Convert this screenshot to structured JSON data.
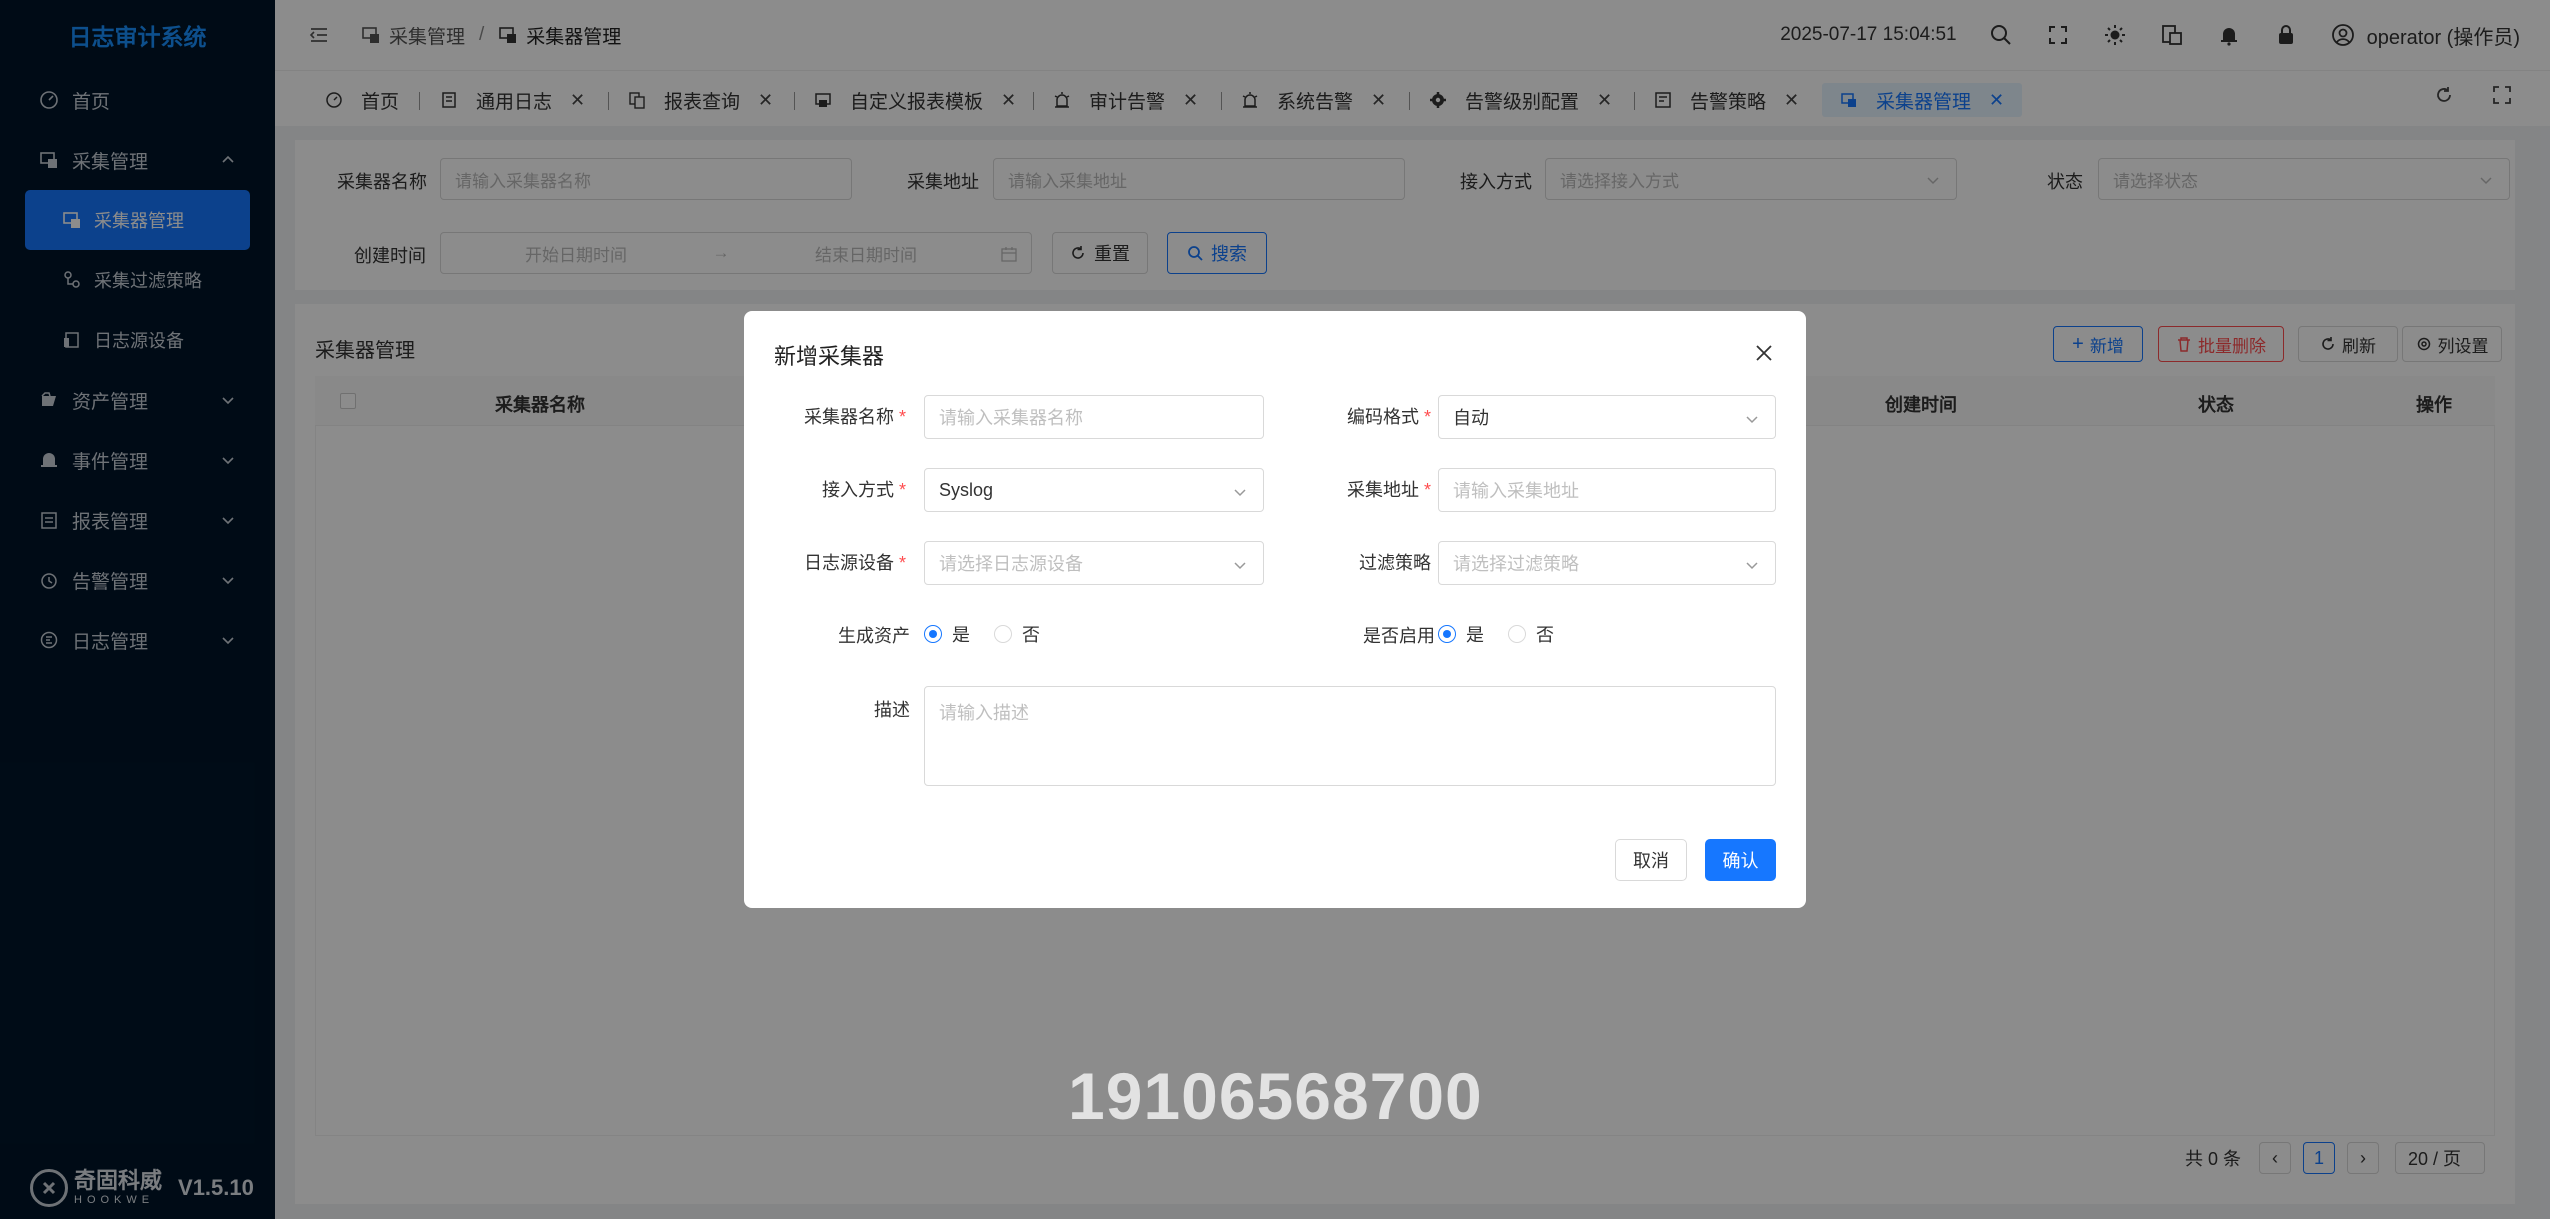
{
  "app": {
    "title": "日志审计系统",
    "version": "V1.5.10",
    "brand_cn": "奇固科威",
    "brand_en": "HOOKWE"
  },
  "sidebar": {
    "items": [
      {
        "label": "首页",
        "icon": "dashboard-icon"
      },
      {
        "label": "采集管理",
        "icon": "collector-icon",
        "expanded": true
      },
      {
        "label": "采集器管理",
        "icon": "collector-icon",
        "sub": true,
        "active": true
      },
      {
        "label": "采集过滤策略",
        "icon": "filter-icon",
        "sub": true
      },
      {
        "label": "日志源设备",
        "icon": "device-icon",
        "sub": true
      },
      {
        "label": "资产管理",
        "icon": "asset-icon"
      },
      {
        "label": "事件管理",
        "icon": "bell-icon"
      },
      {
        "label": "报表管理",
        "icon": "report-icon"
      },
      {
        "label": "告警管理",
        "icon": "alarm-icon"
      },
      {
        "label": "日志管理",
        "icon": "log-icon"
      }
    ]
  },
  "header": {
    "breadcrumb": [
      "采集管理",
      "采集器管理"
    ],
    "datetime": "2025-07-17 15:04:51",
    "user": "operator (操作员)"
  },
  "tabs": [
    {
      "label": "首页",
      "closable": false
    },
    {
      "label": "通用日志",
      "closable": true
    },
    {
      "label": "报表查询",
      "closable": true
    },
    {
      "label": "自定义报表模板",
      "closable": true
    },
    {
      "label": "审计告警",
      "closable": true
    },
    {
      "label": "系统告警",
      "closable": true
    },
    {
      "label": "告警级别配置",
      "closable": true
    },
    {
      "label": "告警策略",
      "closable": true
    },
    {
      "label": "采集器管理",
      "closable": true,
      "active": true
    }
  ],
  "filters": {
    "name_label": "采集器名称",
    "name_placeholder": "请输入采集器名称",
    "addr_label": "采集地址",
    "addr_placeholder": "请输入采集地址",
    "access_label": "接入方式",
    "access_placeholder": "请选择接入方式",
    "status_label": "状态",
    "status_placeholder": "请选择状态",
    "created_label": "创建时间",
    "start_placeholder": "开始日期时间",
    "end_placeholder": "结束日期时间",
    "reset": "重置",
    "search": "搜索"
  },
  "table": {
    "title": "采集器管理",
    "add": "新增",
    "batch_delete": "批量删除",
    "refresh": "刷新",
    "columns": "列设置",
    "headers": {
      "name": "采集器名称",
      "created": "创建时间",
      "status": "状态",
      "ops": "操作"
    },
    "total": "共 0 条",
    "page": "1",
    "page_size": "20 / 页"
  },
  "modal": {
    "title": "新增采集器",
    "name_label": "采集器名称",
    "name_placeholder": "请输入采集器名称",
    "encoding_label": "编码格式",
    "encoding_value": "自动",
    "access_label": "接入方式",
    "access_value": "Syslog",
    "addr_label": "采集地址",
    "addr_placeholder": "请输入采集地址",
    "device_label": "日志源设备",
    "device_placeholder": "请选择日志源设备",
    "filter_label": "过滤策略",
    "filter_placeholder": "请选择过滤策略",
    "gen_asset_label": "生成资产",
    "enabled_label": "是否启用",
    "yes": "是",
    "no": "否",
    "gen_asset_value": "是",
    "enabled_value": "是",
    "desc_label": "描述",
    "desc_placeholder": "请输入描述",
    "cancel": "取消",
    "confirm": "确认"
  },
  "watermark": "19106568700",
  "colors": {
    "primary": "#1677ff",
    "sidebar": "#001529",
    "danger": "#ff4d4f"
  }
}
